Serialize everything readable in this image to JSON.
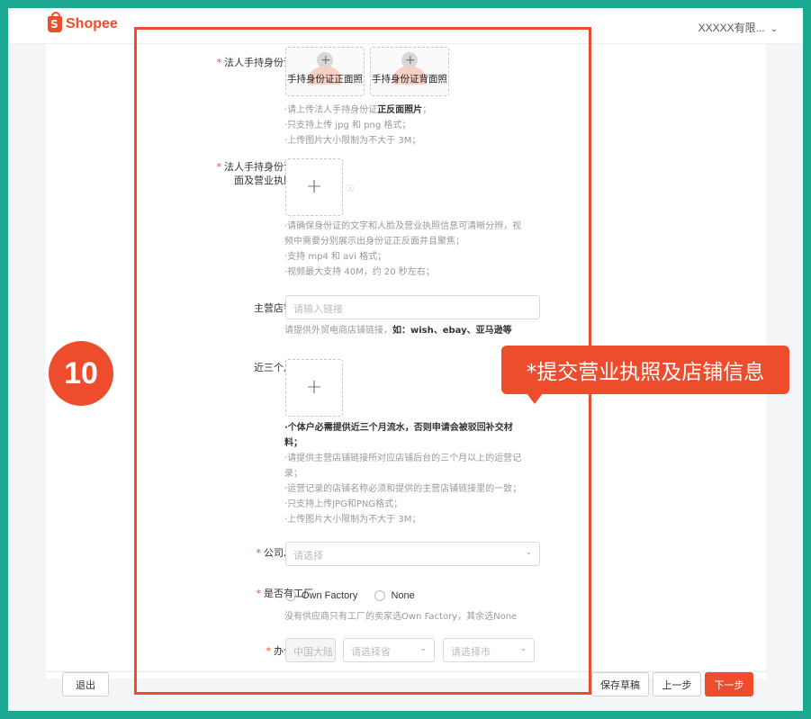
{
  "header": {
    "logo_text": "Shopee",
    "account_name": "XXXXX有限..."
  },
  "form": {
    "id_photo": {
      "label": "法人手持身份证照片",
      "front_caption": "手持身份证正面照",
      "back_caption": "手持身份证背面照",
      "hint1_pre": "·请上传法人手持身份证",
      "hint1_bold": "正反面照片",
      "hint1_post": "；",
      "hint2": "·只支持上传 jpg 和 png 格式；",
      "hint3": "·上传图片大小限制为不大于 3M；"
    },
    "video": {
      "label_line1": "法人手持身份证正反",
      "label_line2": "面及营业执照视频",
      "hint1": "·请确保身份证的文字和人脸及营业执照信息可清晰分辨，视",
      "hint2": "频中需要分别展示出身份证正反面并且聚焦；",
      "hint3": "·支持 mp4 和 avi 格式；",
      "hint4": "·视频最大支持 40M，约 20 秒左右；"
    },
    "store_link": {
      "label": "主营店铺链接",
      "placeholder": "请输入链接",
      "hint_pre": "请提供外贸电商店铺链接，",
      "hint_bold": "如：wish、ebay、亚马逊等"
    },
    "flow": {
      "label": "近三个月流水",
      "hint_bold1": "·个体户必需提供近三个月流水，否则申请会被驳回补交材",
      "hint_bold2": "料；",
      "hint1": "·请提供主营店铺链接所对应店铺后台的三个月以上的运营记",
      "hint2": "录；",
      "hint3": "·运营记录的店铺名称必须和提供的主营店铺链接里的一致；",
      "hint4": "·只支持上传JPG和PNG格式；",
      "hint5": "·上传图片大小限制为不大于 3M；"
    },
    "headcount": {
      "label": "公司总人数",
      "placeholder": "请选择"
    },
    "factory": {
      "label": "是否有工厂",
      "option1": "Own Factory",
      "option2": "None",
      "hint": "没有供应商只有工厂的卖家选Own Factory，其余选None"
    },
    "address": {
      "label": "办公地址",
      "country": "中国大陆",
      "province_placeholder": "请选择省",
      "city_placeholder": "请选择市"
    }
  },
  "footer": {
    "exit": "退出",
    "save_draft": "保存草稿",
    "prev": "上一步",
    "next": "下一步"
  },
  "annotation": {
    "step_number": "10",
    "callout_text": "*提交营业执照及店铺信息"
  },
  "colors": {
    "brand": "#ee4d2d",
    "frame": "#1aa890"
  }
}
